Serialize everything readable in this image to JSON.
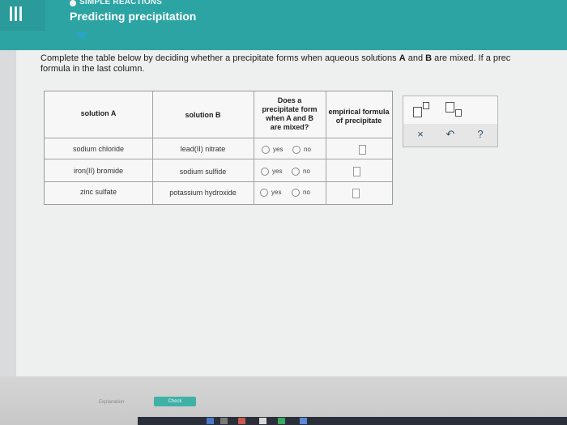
{
  "header": {
    "section": "SIMPLE REACTIONS",
    "title": "Predicting precipitation",
    "accent_color": "#2da4a4"
  },
  "instructions": {
    "pre": "Complete the table below by deciding whether a precipitate forms when aqueous solutions ",
    "a": "A",
    "mid": " and ",
    "b": "B",
    "post": " are mixed. If a prec",
    "line2": "formula in the last column."
  },
  "table": {
    "headers": {
      "solution_a": "solution A",
      "solution_b": "solution B",
      "precipitate_line1": "Does a",
      "precipitate_line2": "precipitate form",
      "precipitate_line3": "when A and B",
      "precipitate_line4": "are mixed?",
      "formula_line1": "empirical formula",
      "formula_line2": "of precipitate"
    },
    "rows": [
      {
        "a": "sodium chloride",
        "b": "lead(II) nitrate",
        "yes": "yes",
        "no": "no"
      },
      {
        "a": "iron(II) bromide",
        "b": "sodium sulfide",
        "yes": "yes",
        "no": "no"
      },
      {
        "a": "zinc sulfate",
        "b": "potassium hydroxide",
        "yes": "yes",
        "no": "no"
      }
    ]
  },
  "tools": {
    "clear": "×",
    "undo": "↶",
    "help": "?"
  },
  "footer": {
    "explanation": "Explanation",
    "check": "Check"
  }
}
